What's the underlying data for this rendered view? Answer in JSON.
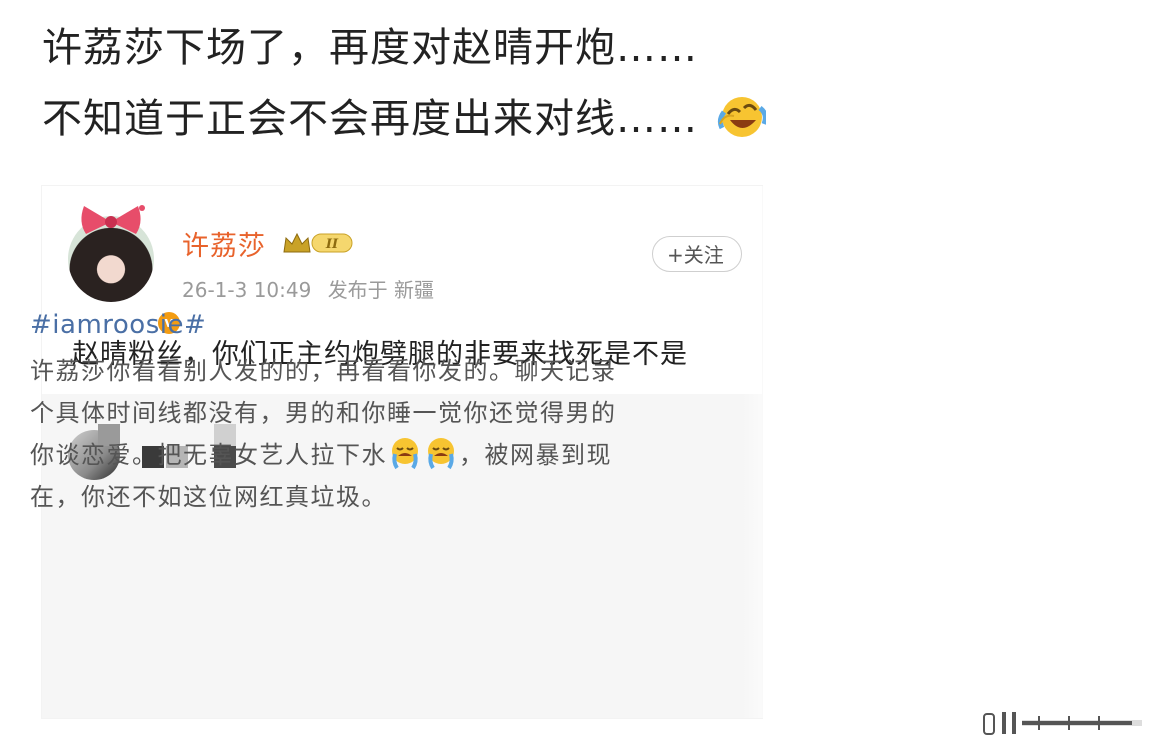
{
  "caption": {
    "line1": "许荔莎下场了，再度对赵晴开炮……",
    "line2": "不知道于正会不会再度出来对线……"
  },
  "post": {
    "username": "许荔莎",
    "badge_text": "II",
    "time": "26-1-3 10:49",
    "location": "发布于 新疆",
    "text": "赵晴粉丝，你们正主约炮劈腿的非要来找死是不是"
  },
  "quoted": {
    "follow_label": "+关注",
    "hashtag": "#iamroosie#",
    "lines": [
      "许荔莎你看看别人发的的，再看看你发的。聊天记录",
      "个具体时间线都没有，男的和你睡一觉你还觉得男的",
      "你谈恋爱。把无辜女艺人拉下水",
      "，被网暴到现",
      "在，你还不如这位网红真垃圾。"
    ]
  },
  "colors": {
    "username": "#e8632c",
    "hashtag": "#4a6fa5",
    "verified": "#f39c12"
  },
  "icons": [
    "laughing-crying-emoji",
    "bow-icon",
    "crown-badge-icon",
    "verified-icon",
    "crying-emoji"
  ]
}
